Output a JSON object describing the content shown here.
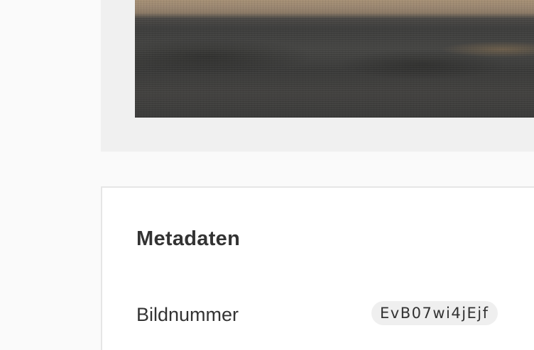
{
  "metadata": {
    "title": "Metadaten",
    "rows": [
      {
        "label": "Bildnummer",
        "value": "EvB07wi4jEjf"
      }
    ]
  }
}
